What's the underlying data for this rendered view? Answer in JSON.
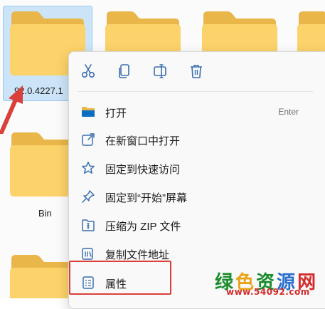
{
  "explorer": {
    "folders": [
      {
        "label": "92.0.4227.1"
      },
      {
        "label": "Bin"
      }
    ]
  },
  "context_menu": {
    "quick_actions": [
      {
        "name": "cut",
        "icon": "scissors-icon"
      },
      {
        "name": "copy",
        "icon": "copy-icon"
      },
      {
        "name": "rename",
        "icon": "rename-icon"
      },
      {
        "name": "delete",
        "icon": "trash-icon"
      }
    ],
    "items": [
      {
        "label": "打开",
        "shortcut": "Enter",
        "icon": "folder-open-icon"
      },
      {
        "label": "在新窗口中打开",
        "icon": "open-new-window-icon"
      },
      {
        "label": "固定到快速访问",
        "icon": "star-icon"
      },
      {
        "label": "固定到“开始”屏幕",
        "icon": "pin-icon"
      },
      {
        "label": "压缩为 ZIP 文件",
        "icon": "zip-icon"
      },
      {
        "label": "复制文件地址",
        "icon": "copy-path-icon"
      },
      {
        "label": "属性",
        "icon": "properties-icon"
      }
    ],
    "accent_color": "#0067c0"
  },
  "annotation": {
    "highlight_color": "#d9403a"
  },
  "watermark": {
    "title_chars": [
      "绿",
      "色",
      "资",
      "源",
      "网"
    ],
    "title_colors": [
      "#1a8c2b",
      "#e8a317",
      "#1a8c2b",
      "#2a6fcf",
      "#d32b2b"
    ],
    "url": "www.54092.com"
  }
}
